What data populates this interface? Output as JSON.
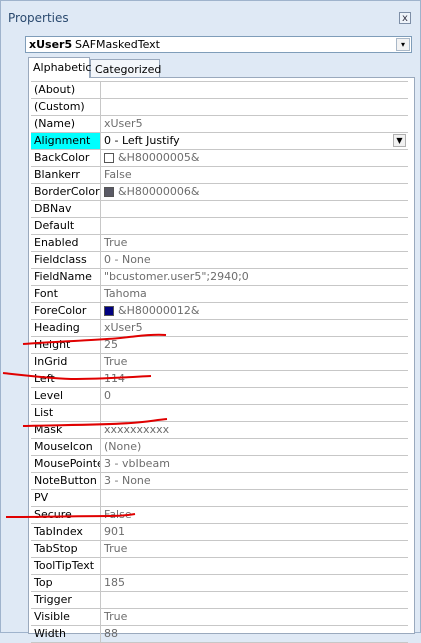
{
  "window": {
    "title": "Properties",
    "close_label": "x"
  },
  "object_selector": {
    "name": "xUser5",
    "type": "SAFMaskedText",
    "arrow": "▾"
  },
  "tabs": [
    {
      "label": "Alphabetic",
      "active": true
    },
    {
      "label": "Categorized",
      "active": false
    }
  ],
  "properties": [
    {
      "name": "(About)",
      "value": ""
    },
    {
      "name": "(Custom)",
      "value": ""
    },
    {
      "name": "(Name)",
      "value": "xUser5"
    },
    {
      "name": "Alignment",
      "value": "0 - Left Justify",
      "selected": true,
      "dropdown": true
    },
    {
      "name": "BackColor",
      "value": "&H80000005&",
      "swatch": "#ffffff"
    },
    {
      "name": "Blankerr",
      "value": "False"
    },
    {
      "name": "BorderColor",
      "value": "&H80000006&",
      "swatch": "#5b5b66"
    },
    {
      "name": "DBNav",
      "value": ""
    },
    {
      "name": "Default",
      "value": ""
    },
    {
      "name": "Enabled",
      "value": "True"
    },
    {
      "name": "Fieldclass",
      "value": "0 - None"
    },
    {
      "name": "FieldName",
      "value": "\"bcustomer.user5\";2940;0"
    },
    {
      "name": "Font",
      "value": "Tahoma"
    },
    {
      "name": "ForeColor",
      "value": "&H80000012&",
      "swatch": "#000080"
    },
    {
      "name": "Heading",
      "value": "xUser5"
    },
    {
      "name": "Height",
      "value": "25"
    },
    {
      "name": "InGrid",
      "value": "True"
    },
    {
      "name": "Left",
      "value": "114"
    },
    {
      "name": "Level",
      "value": "0"
    },
    {
      "name": "List",
      "value": ""
    },
    {
      "name": "Mask",
      "value": "xxxxxxxxxx"
    },
    {
      "name": "MouseIcon",
      "value": "(None)"
    },
    {
      "name": "MousePointer",
      "value": "3 - vbIbeam"
    },
    {
      "name": "NoteButton",
      "value": "3 - None"
    },
    {
      "name": "PV",
      "value": ""
    },
    {
      "name": "Secure",
      "value": "False"
    },
    {
      "name": "TabIndex",
      "value": "901"
    },
    {
      "name": "TabStop",
      "value": "True"
    },
    {
      "name": "ToolTipText",
      "value": ""
    },
    {
      "name": "Top",
      "value": "185"
    },
    {
      "name": "Trigger",
      "value": ""
    },
    {
      "name": "Visible",
      "value": "True"
    },
    {
      "name": "Width",
      "value": "88"
    }
  ],
  "colors": {
    "selection": "#00ffff",
    "annotation": "#e00000"
  }
}
